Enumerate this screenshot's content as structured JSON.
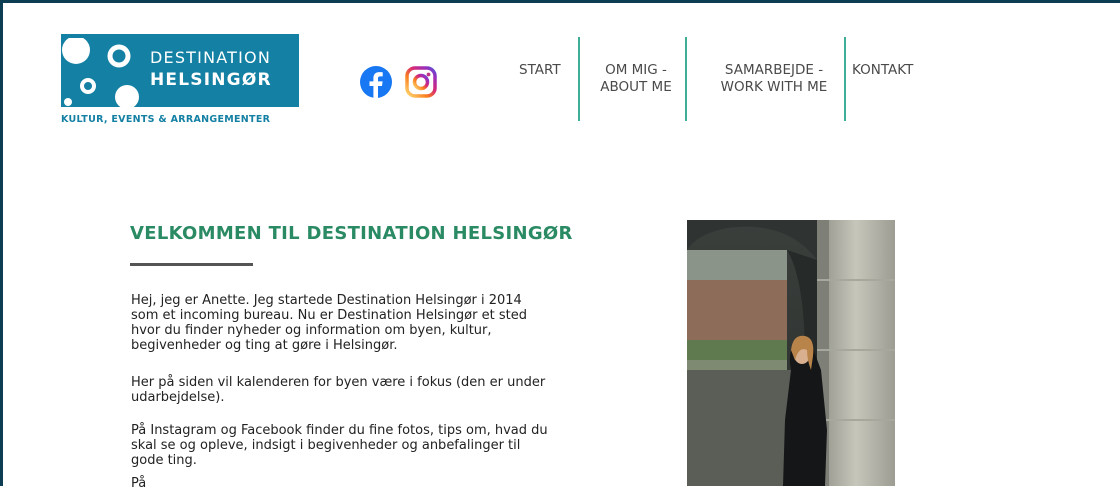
{
  "logo": {
    "line1": "DESTINATION",
    "line2": "HELSINGØR",
    "tagline": "KULTUR, EVENTS & ARRANGEMENTER"
  },
  "social": {
    "facebook_icon": "facebook-icon",
    "instagram_icon": "instagram-icon"
  },
  "nav": {
    "start": "START",
    "om_mig": [
      "OM MIG -",
      "ABOUT ME"
    ],
    "samarbejde": [
      "SAMARBEJDE -",
      "WORK WITH ME"
    ],
    "kontakt": "KONTAKT"
  },
  "main": {
    "heading": "VELKOMMEN TIL DESTINATION HELSINGØR",
    "paragraphs": [
      "Hej, jeg er Anette. Jeg startede Destination Helsingør i 2014 som et incoming bureau. Nu er Destination Helsingør et sted hvor du finder nyheder og information om byen, kultur, begivenheder og ting at gøre i Helsingør.",
      "Her på siden vil kalenderen for byen være i fokus (den er under udarbejdelse).",
      "På Instagram og Facebook finder du fine fotos, tips om, hvad du skal se og opleve, indsigt i begivenheder og anbefalinger til gode ting.",
      "På"
    ]
  },
  "colors": {
    "brand_blue": "#1480a3",
    "heading_green": "#2a8a64",
    "nav_divider": "#3fae97",
    "frame": "#0d3d52"
  }
}
